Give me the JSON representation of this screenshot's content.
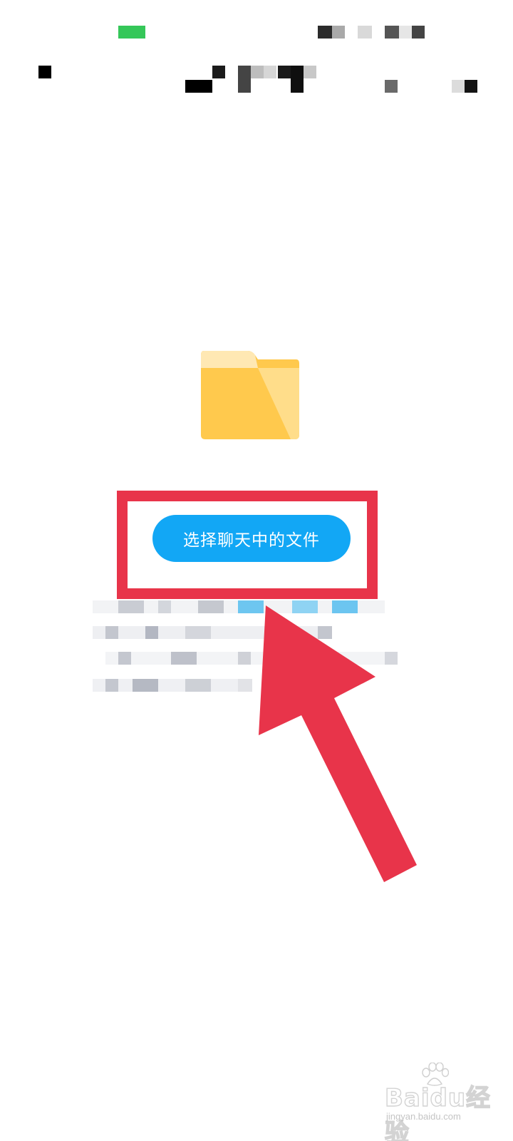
{
  "status_bar": {
    "battery_color": "#35c759"
  },
  "main": {
    "folder_icon": "folder-icon",
    "select_button_label": "选择聊天中的文件",
    "button_color": "#12a7f5",
    "highlight_color": "#e8344a",
    "arrow_color": "#e8344a"
  },
  "watermark": {
    "logo_text": "Baidu经验",
    "url": "jingyan.baidu.com"
  }
}
